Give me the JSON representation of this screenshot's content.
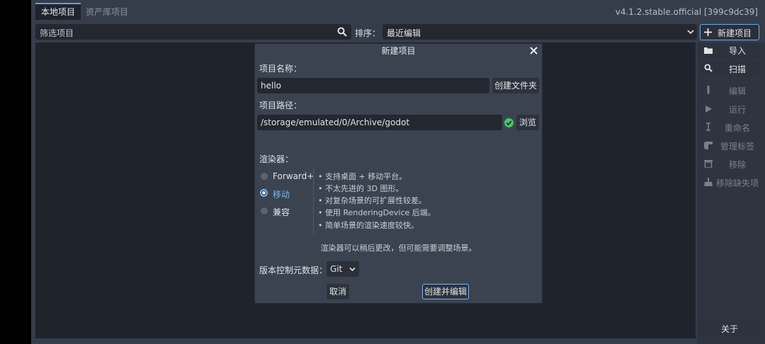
{
  "header": {
    "tabs": [
      {
        "label": "本地项目",
        "active": true
      },
      {
        "label": "资产库项目",
        "active": false
      }
    ],
    "version": "v4.1.2.stable.official [399c9dc39]"
  },
  "toolbar": {
    "filter_placeholder": "筛选项目",
    "sort_label": "排序：",
    "sort_value": "最近编辑",
    "new_project_label": "新建项目"
  },
  "sidebar": {
    "items": [
      {
        "label": "导入",
        "icon": "folder-icon",
        "enabled": true
      },
      {
        "label": "扫描",
        "icon": "search-icon",
        "enabled": true
      },
      {
        "label": "编辑",
        "icon": "edit-icon",
        "enabled": false
      },
      {
        "label": "运行",
        "icon": "play-icon",
        "enabled": false
      },
      {
        "label": "重命名",
        "icon": "rename-icon",
        "enabled": false
      },
      {
        "label": "管理标签",
        "icon": "tag-icon",
        "enabled": false
      },
      {
        "label": "移除",
        "icon": "trash-icon",
        "enabled": false
      },
      {
        "label": "移除缺失项",
        "icon": "broom-icon",
        "enabled": false
      }
    ],
    "about_label": "关于"
  },
  "dialog": {
    "title": "新建项目",
    "project_name_label": "项目名称：",
    "project_name_value": "hello",
    "create_folder_label": "创建文件夹",
    "project_path_label": "项目路径：",
    "project_path_value": "/storage/emulated/0/Archive/godot",
    "browse_label": "浏览",
    "renderer_label": "渲染器：",
    "renderers": [
      {
        "label": "Forward+",
        "selected": false
      },
      {
        "label": "移动",
        "selected": true
      },
      {
        "label": "兼容",
        "selected": false
      }
    ],
    "renderer_description": [
      "•  支持桌面 + 移动平台。",
      "•  不太先进的 3D 图形。",
      "•  对复杂场景的可扩展性较差。",
      "•  使用 RenderingDevice 后端。",
      "•  简单场景的渲染速度较快。"
    ],
    "renderer_note": "渲染器可以稍后更改，但可能需要调整场景。",
    "vcs_label": "版本控制元数据：",
    "vcs_value": "Git",
    "cancel_label": "取消",
    "create_label": "创建并编辑"
  },
  "colors": {
    "accent": "#5aa0f0",
    "valid": "#45c66a",
    "background": "#363d4a",
    "panel": "#1f242c"
  }
}
